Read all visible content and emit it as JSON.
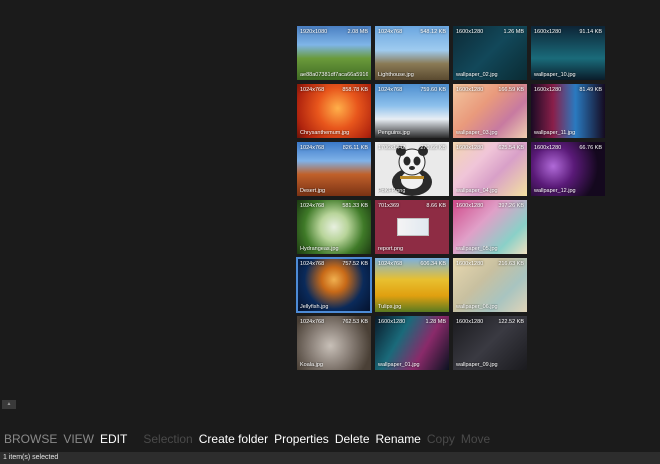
{
  "grid": {
    "tiles": [
      {
        "dims": "1920x1080",
        "size": "2.08 MB",
        "name": "ae88a07381df7aca66a5916..."
      },
      {
        "dims": "1024x768",
        "size": "548.12 KB",
        "name": "Lighthouse.jpg"
      },
      {
        "dims": "1600x1280",
        "size": "1.26 MB",
        "name": "wallpaper_02.jpg"
      },
      {
        "dims": "1600x1280",
        "size": "91.14 KB",
        "name": "wallpaper_10.jpg"
      },
      {
        "dims": "1024x768",
        "size": "858.78 KB",
        "name": "Chrysanthemum.jpg"
      },
      {
        "dims": "1024x768",
        "size": "759.60 KB",
        "name": "Penguins.jpg"
      },
      {
        "dims": "1600x1280",
        "size": "166.59 KB",
        "name": "wallpaper_03.jpg"
      },
      {
        "dims": "1600x1280",
        "size": "81.49 KB",
        "name": "wallpaper_11.jpg"
      },
      {
        "dims": "1024x768",
        "size": "826.11 KB",
        "name": "Desert.jpg"
      },
      {
        "dims": "1706x1442",
        "size": "270.66 KB",
        "name": "PoKFP.png"
      },
      {
        "dims": "1600x1280",
        "size": "625.54 KB",
        "name": "wallpaper_04.jpg"
      },
      {
        "dims": "1600x1280",
        "size": "66.76 KB",
        "name": "wallpaper_12.jpg"
      },
      {
        "dims": "1024x768",
        "size": "581.33 KB",
        "name": "Hydrangeas.jpg"
      },
      {
        "dims": "701x369",
        "size": "8.66 KB",
        "name": "report.png"
      },
      {
        "dims": "1600x1280",
        "size": "397.26 KB",
        "name": "wallpaper_05.jpg"
      },
      {
        "dims": "1024x768",
        "size": "757.52 KB",
        "name": "Jellyfish.jpg"
      },
      {
        "dims": "1024x768",
        "size": "606.34 KB",
        "name": "Tulips.jpg"
      },
      {
        "dims": "1600x1280",
        "size": "216.63 KB",
        "name": "wallpaper_06.jpg"
      },
      {
        "dims": "1024x768",
        "size": "762.53 KB",
        "name": "Koala.jpg"
      },
      {
        "dims": "1600x1280",
        "size": "1.28 MB",
        "name": "wallpaper_01.jpg"
      },
      {
        "dims": "1600x1280",
        "size": "122.52 KB",
        "name": "wallpaper_09.jpg"
      }
    ]
  },
  "collapse_button": {
    "label": "▲"
  },
  "command_bar": {
    "browse": "BROWSE",
    "view": "VIEW",
    "edit": "EDIT",
    "selection": "Selection",
    "create_folder": "Create folder",
    "properties": "Properties",
    "delete": "Delete",
    "rename": "Rename",
    "copy": "Copy",
    "move": "Move"
  },
  "status_bar": {
    "text": "1 item(s) selected"
  },
  "colors": {
    "background": "#1b1b1b",
    "status_bar": "#2d2d2d",
    "selection": "#4d8bd6",
    "disabled_text": "#4a4a4a",
    "inactive_mode_text": "#8a8a8a"
  }
}
